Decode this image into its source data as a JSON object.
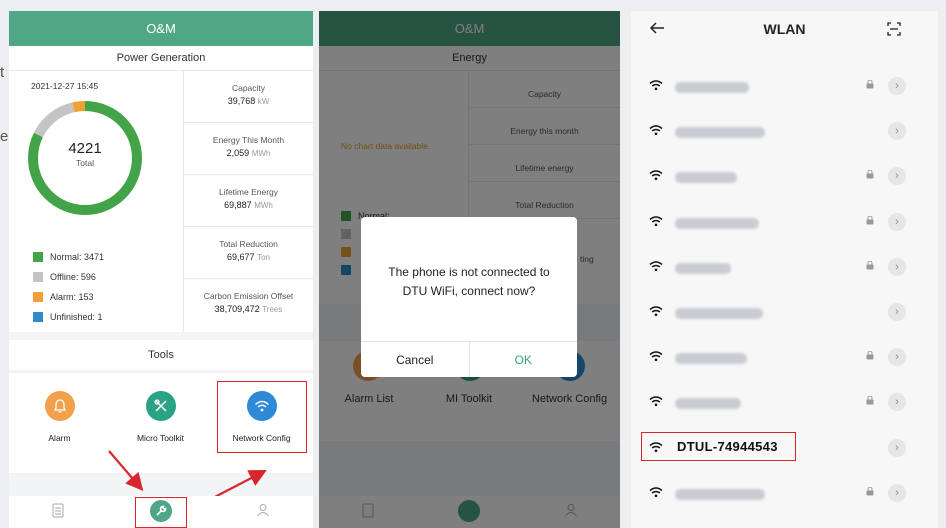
{
  "panel1": {
    "header": "O&M",
    "section_title": "Power Generation",
    "timestamp": "2021-12-27 15:45",
    "total_value": "4221",
    "total_label": "Total",
    "legend": [
      {
        "label": "Normal: 3471",
        "color": "#43a348"
      },
      {
        "label": "Offline: 596",
        "color": "#c4c4c4"
      },
      {
        "label": "Alarm: 153",
        "color": "#f0a035"
      },
      {
        "label": "Unfinished: 1",
        "color": "#2f8cc8"
      }
    ],
    "donut": {
      "normal": 3471,
      "offline": 596,
      "alarm": 153,
      "unfinished": 1
    },
    "stats": [
      {
        "title": "Capacity",
        "value": "39,768",
        "unit": "kW"
      },
      {
        "title": "Energy This Month",
        "value": "2,059",
        "unit": "MWh"
      },
      {
        "title": "Lifetime Energy",
        "value": "69,887",
        "unit": "MWh"
      },
      {
        "title": "Total Reduction",
        "value": "69,677",
        "unit": "Ton"
      },
      {
        "title": "Carbon Emission Offset",
        "value": "38,709,472",
        "unit": "Trees"
      }
    ],
    "tools_title": "Tools",
    "tools": [
      {
        "label": "Alarm",
        "color": "#f3a04a"
      },
      {
        "label": "Micro Toolkit",
        "color": "#2aa286"
      },
      {
        "label": "Network Config",
        "color": "#2c8ad6"
      }
    ]
  },
  "panel2": {
    "header": "O&M",
    "section_title": "Energy",
    "no_data": "No chart data available.",
    "stats": [
      "Capacity",
      "Energy this month",
      "Lifetime energy",
      "Total Reduction"
    ],
    "legend_partial": "Normal:",
    "stat_partial": "ting",
    "tools": [
      "Alarm List",
      "MI Toolkit",
      "Network Config"
    ],
    "dialog": {
      "message": "The phone is not connected to DTU WiFi, connect now?",
      "cancel": "Cancel",
      "ok": "OK"
    }
  },
  "panel3": {
    "title": "WLAN",
    "highlighted_network": "DTUL-74944543",
    "rows": [
      {
        "blur_w": 74,
        "lock": true
      },
      {
        "blur_w": 90,
        "lock": false
      },
      {
        "blur_w": 62,
        "lock": true
      },
      {
        "blur_w": 84,
        "lock": true
      },
      {
        "blur_w": 56,
        "lock": true
      },
      {
        "blur_w": 88,
        "lock": false
      },
      {
        "blur_w": 72,
        "lock": true
      },
      {
        "blur_w": 66,
        "lock": true
      },
      {
        "highlight": true,
        "lock": false
      },
      {
        "blur_w": 90,
        "lock": true
      }
    ]
  },
  "side_fragments": [
    "t",
    "e"
  ]
}
